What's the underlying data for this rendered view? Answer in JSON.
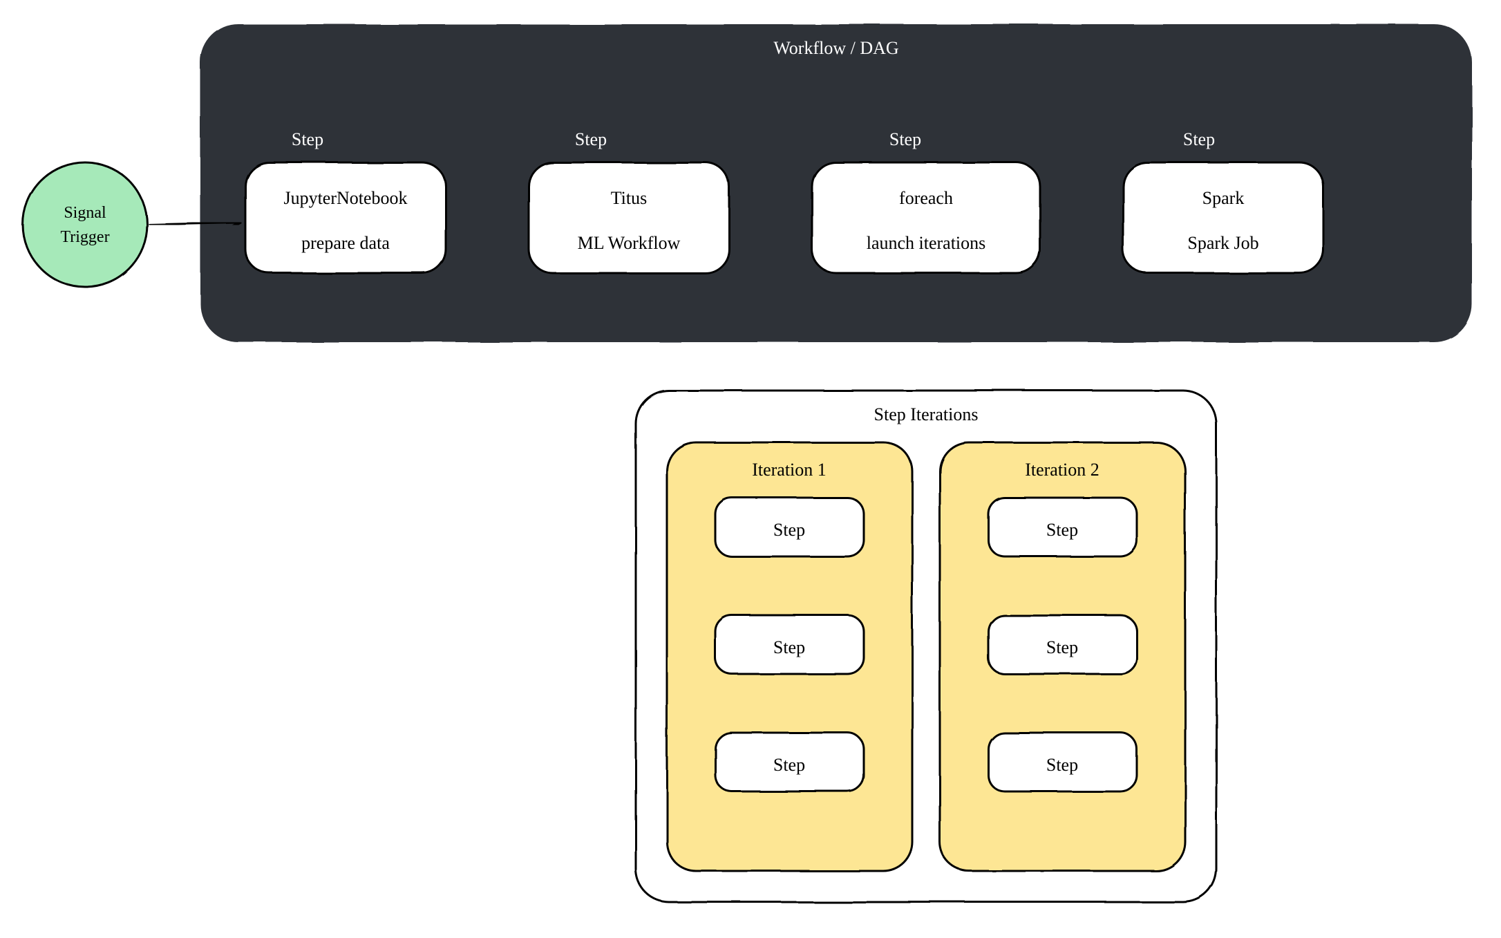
{
  "colors": {
    "dark": "#2f3338",
    "trigger": "#a6e9b9",
    "iteration": "#fde694",
    "stroke": "#000000"
  },
  "trigger": {
    "line1": "Signal",
    "line2": "Trigger"
  },
  "workflow": {
    "title": "Workflow / DAG",
    "steps": [
      {
        "label": "Step",
        "line1": "JupyterNotebook",
        "line2": "prepare data"
      },
      {
        "label": "Step",
        "line1": "Titus",
        "line2": "ML Workflow"
      },
      {
        "label": "Step",
        "line1": "foreach",
        "line2": "launch iterations"
      },
      {
        "label": "Step",
        "line1": "Spark",
        "line2": "Spark Job"
      }
    ]
  },
  "iterations": {
    "title": "Step Iterations",
    "groups": [
      {
        "title": "Iteration 1",
        "steps": [
          "Step",
          "Step",
          "Step"
        ]
      },
      {
        "title": "Iteration 2",
        "steps": [
          "Step",
          "Step",
          "Step"
        ]
      }
    ]
  }
}
